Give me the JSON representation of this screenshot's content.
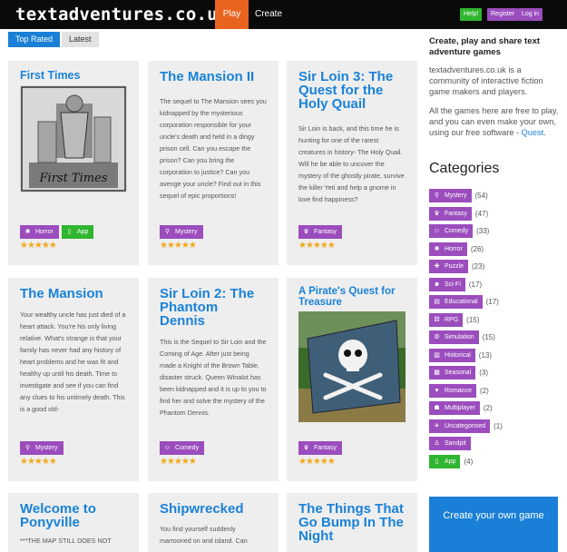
{
  "header": {
    "logo": "textadventures.co.uk",
    "nav": {
      "play": "Play",
      "create": "Create"
    },
    "buttons": {
      "help": "Help!",
      "register": "Register",
      "login": "Log in"
    }
  },
  "tabs": {
    "top_rated": "Top Rated",
    "latest": "Latest"
  },
  "games": [
    {
      "title": "First Times",
      "description": "",
      "tags": [
        {
          "label": "Horror",
          "icon": "horror-icon"
        },
        {
          "label": "App",
          "icon": "app-icon"
        }
      ],
      "stars": "★★★★★"
    },
    {
      "title": "The Mansion II",
      "description": "The sequel to The Mansion sees you kidnapped by the mysterious corporation responsible for your uncle's death and held in a dingy prison cell. Can you escape the prison? Can you bring the corporation to justice? Can you avenge your uncle? Find out in this sequel of epic proportions!",
      "tags": [
        {
          "label": "Mystery",
          "icon": "mystery-icon"
        }
      ],
      "stars": "★★★★★"
    },
    {
      "title": "Sir Loin 3: The Quest for the Holy Quail",
      "description": "Sir Loin is back, and this time he is hunting for one of the rarest creatures in history- The Holy Quail. Will he be able to uncover the mystery of the ghostly pirate, survive the killer Yeti and help a gnome in love find happiness?",
      "tags": [
        {
          "label": "Fantasy",
          "icon": "fantasy-icon"
        }
      ],
      "stars": "★★★★★"
    },
    {
      "title": "The Mansion",
      "description": "Your wealthy uncle has just died of a heart attack. You're his only living relative. What's strange is that your family has never had any history of heart problems and he was fit and healthy up until his death. Time to investigate and see if you can find any clues to his untimely death. This is a good old-",
      "tags": [
        {
          "label": "Mystery",
          "icon": "mystery-icon"
        }
      ],
      "stars": "★★★★★"
    },
    {
      "title": "Sir Loin 2: The Phantom Dennis",
      "description": "This is the Sequel to Sir Loin and the Coming of Age. After just being made a Knight of the Brown Table, disaster struck. Queen Winalot has been kidnapped and it is up to you to find her and solve the mystery of the Phantom Dennis.",
      "tags": [
        {
          "label": "Comedy",
          "icon": "comedy-icon"
        }
      ],
      "stars": "★★★★★"
    },
    {
      "title": "A Pirate's Quest for Treasure",
      "description": "",
      "tags": [
        {
          "label": "Fantasy",
          "icon": "fantasy-icon"
        }
      ],
      "stars": "★★★★★"
    },
    {
      "title": "Welcome to Ponyville",
      "description": "***THE MAP STILL DOES NOT",
      "tags": [],
      "stars": ""
    },
    {
      "title": "Shipwrecked",
      "description": "You find yourself suddenly marrooned on and island. Can",
      "tags": [],
      "stars": ""
    },
    {
      "title": "The Things That Go Bump In The Night",
      "description": "",
      "tags": [],
      "stars": ""
    }
  ],
  "sidebar": {
    "heading": "Create, play and share text adventure games",
    "intro": "textadventures.co.uk is a community of interactive fiction game makers and players.",
    "free_text": "All the games here are free to play, and you can even make your own, using our free software - ",
    "quest_link": "Quest",
    "period": ".",
    "categories_title": "Categories",
    "categories": [
      {
        "label": "Mystery",
        "count": "(54)",
        "icon": "magnifier-icon",
        "color": "#9b4dbd"
      },
      {
        "label": "Fantasy",
        "count": "(47)",
        "icon": "crown-icon",
        "color": "#9b4dbd"
      },
      {
        "label": "Comedy",
        "count": "(33)",
        "icon": "smiley-icon",
        "color": "#9b4dbd"
      },
      {
        "label": "Horror",
        "count": "(26)",
        "icon": "splat-icon",
        "color": "#9b4dbd"
      },
      {
        "label": "Puzzle",
        "count": "(23)",
        "icon": "puzzle-icon",
        "color": "#9b4dbd"
      },
      {
        "label": "Sci-Fi",
        "count": "(17)",
        "icon": "alien-icon",
        "color": "#9b4dbd"
      },
      {
        "label": "Educational",
        "count": "(17)",
        "icon": "book-icon",
        "color": "#9b4dbd"
      },
      {
        "label": "RPG",
        "count": "(15)",
        "icon": "dice-icon",
        "color": "#9b4dbd"
      },
      {
        "label": "Simulation",
        "count": "(15)",
        "icon": "gears-icon",
        "color": "#9b4dbd"
      },
      {
        "label": "Historical",
        "count": "(13)",
        "icon": "scroll-icon",
        "color": "#9b4dbd"
      },
      {
        "label": "Seasonal",
        "count": "(3)",
        "icon": "calendar-icon",
        "color": "#9b4dbd"
      },
      {
        "label": "Romance",
        "count": "(2)",
        "icon": "heart-icon",
        "color": "#9b4dbd"
      },
      {
        "label": "Multiplayer",
        "count": "(2)",
        "icon": "people-icon",
        "color": "#9b4dbd"
      },
      {
        "label": "Uncategorised",
        "count": "(1)",
        "icon": "unknown-icon",
        "color": "#9b4dbd"
      },
      {
        "label": "Sandpit",
        "count": "",
        "icon": "figure-icon",
        "color": "#9b4dbd"
      },
      {
        "label": "App",
        "count": "(4)",
        "icon": "phone-icon",
        "color": "#2fb52f"
      }
    ],
    "create_box": "Create your own game"
  },
  "colors": {
    "accent": "#1a7fd6",
    "tag": "#9b4dbd",
    "app": "#2fb52f",
    "play": "#e8641e"
  }
}
